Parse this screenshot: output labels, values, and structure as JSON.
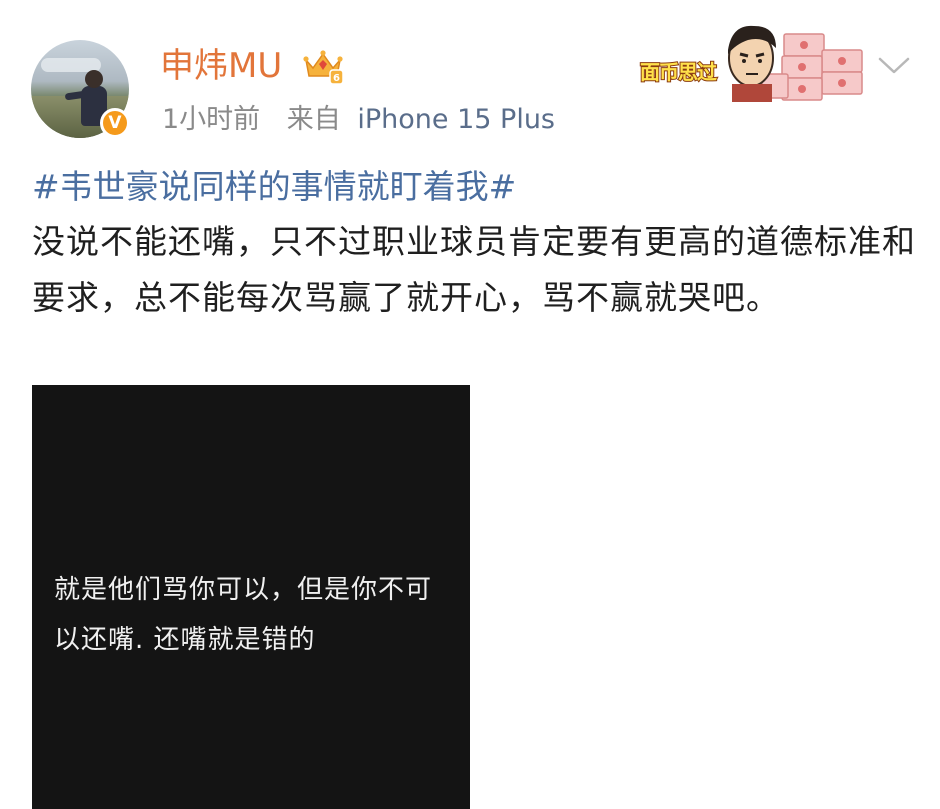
{
  "user": {
    "name": "申炜MU",
    "verified_badge": "V",
    "avatar_icon": "avatar-photo"
  },
  "meta": {
    "time": "1小时前",
    "source_label": "来自",
    "device": "iPhone 15 Plus"
  },
  "sticker": {
    "text": "面币思过",
    "icon": "money-stack-sticker"
  },
  "post": {
    "topic": "#韦世豪说同样的事情就盯着我#",
    "text": "没说不能还嘴，只不过职业球员肯定要有更高的道德标准和要求，总不能每次骂赢了就开心，骂不赢就哭吧。"
  },
  "video": {
    "subtitle": "就是他们骂你可以，但是你不可以还嘴. 还嘴就是错的"
  },
  "colors": {
    "username": "#e2753a",
    "topic": "#4a6ea0",
    "badge": "#f59a1b",
    "meta": "#8a8a8a",
    "video_bg": "#141414"
  }
}
